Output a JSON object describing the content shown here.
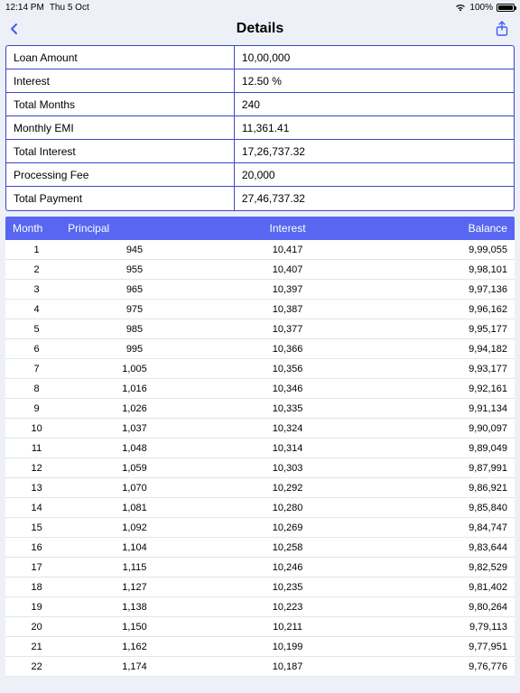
{
  "status": {
    "time": "12:14 PM",
    "date": "Thu 5 Oct",
    "battery_pct": "100%"
  },
  "nav": {
    "title": "Details"
  },
  "summary": [
    {
      "label": "Loan Amount",
      "value": "10,00,000"
    },
    {
      "label": "Interest",
      "value": "12.50 %"
    },
    {
      "label": "Total Months",
      "value": "240"
    },
    {
      "label": "Monthly EMI",
      "value": "11,361.41"
    },
    {
      "label": "Total Interest",
      "value": "17,26,737.32"
    },
    {
      "label": "Processing Fee",
      "value": "20,000"
    },
    {
      "label": "Total Payment",
      "value": "27,46,737.32"
    }
  ],
  "grid_headers": {
    "c1": "Month",
    "c2": "Principal",
    "c3": "Interest",
    "c4": "Balance"
  },
  "rows": [
    {
      "m": "1",
      "p": "945",
      "i": "10,417",
      "b": "9,99,055"
    },
    {
      "m": "2",
      "p": "955",
      "i": "10,407",
      "b": "9,98,101"
    },
    {
      "m": "3",
      "p": "965",
      "i": "10,397",
      "b": "9,97,136"
    },
    {
      "m": "4",
      "p": "975",
      "i": "10,387",
      "b": "9,96,162"
    },
    {
      "m": "5",
      "p": "985",
      "i": "10,377",
      "b": "9,95,177"
    },
    {
      "m": "6",
      "p": "995",
      "i": "10,366",
      "b": "9,94,182"
    },
    {
      "m": "7",
      "p": "1,005",
      "i": "10,356",
      "b": "9,93,177"
    },
    {
      "m": "8",
      "p": "1,016",
      "i": "10,346",
      "b": "9,92,161"
    },
    {
      "m": "9",
      "p": "1,026",
      "i": "10,335",
      "b": "9,91,134"
    },
    {
      "m": "10",
      "p": "1,037",
      "i": "10,324",
      "b": "9,90,097"
    },
    {
      "m": "11",
      "p": "1,048",
      "i": "10,314",
      "b": "9,89,049"
    },
    {
      "m": "12",
      "p": "1,059",
      "i": "10,303",
      "b": "9,87,991"
    },
    {
      "m": "13",
      "p": "1,070",
      "i": "10,292",
      "b": "9,86,921"
    },
    {
      "m": "14",
      "p": "1,081",
      "i": "10,280",
      "b": "9,85,840"
    },
    {
      "m": "15",
      "p": "1,092",
      "i": "10,269",
      "b": "9,84,747"
    },
    {
      "m": "16",
      "p": "1,104",
      "i": "10,258",
      "b": "9,83,644"
    },
    {
      "m": "17",
      "p": "1,115",
      "i": "10,246",
      "b": "9,82,529"
    },
    {
      "m": "18",
      "p": "1,127",
      "i": "10,235",
      "b": "9,81,402"
    },
    {
      "m": "19",
      "p": "1,138",
      "i": "10,223",
      "b": "9,80,264"
    },
    {
      "m": "20",
      "p": "1,150",
      "i": "10,211",
      "b": "9,79,113"
    },
    {
      "m": "21",
      "p": "1,162",
      "i": "10,199",
      "b": "9,77,951"
    },
    {
      "m": "22",
      "p": "1,174",
      "i": "10,187",
      "b": "9,76,776"
    }
  ]
}
